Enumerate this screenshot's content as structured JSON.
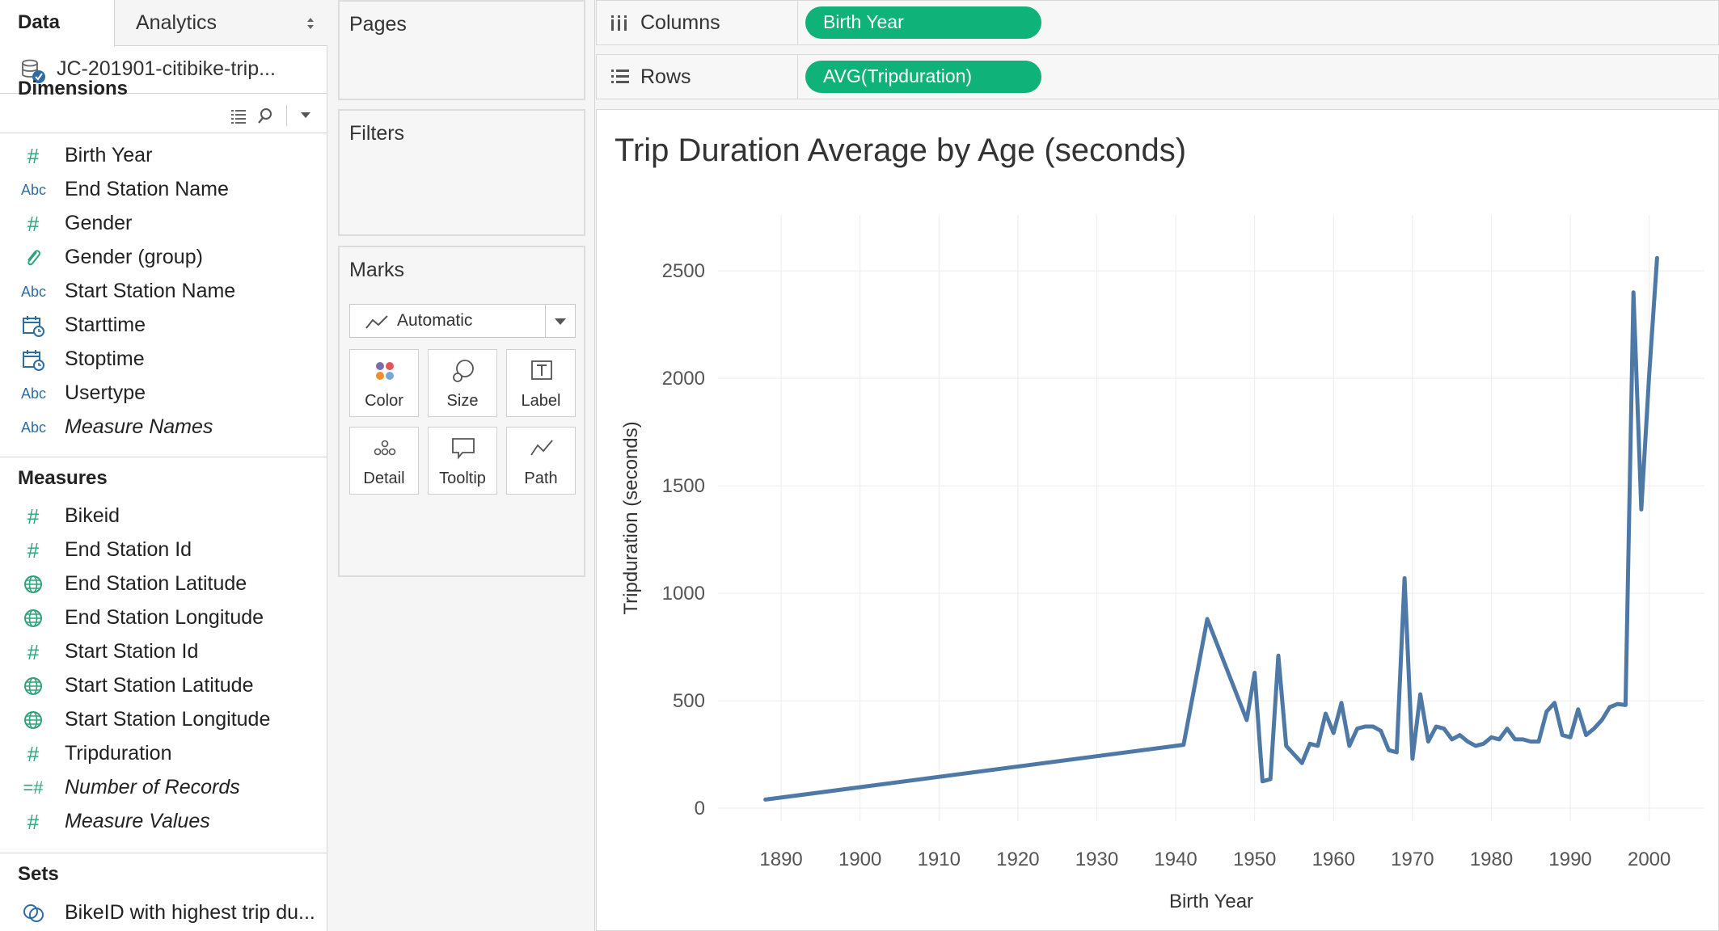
{
  "tabs": {
    "data": "Data",
    "analytics": "Analytics"
  },
  "datasource": {
    "label": "JC-201901-citibike-trip...",
    "icon": "datasource-icon"
  },
  "dimensions": {
    "heading": "Dimensions",
    "items": [
      {
        "label": "Birth Year",
        "icon": "number-icon",
        "italic": false
      },
      {
        "label": "End Station Name",
        "icon": "abc-icon",
        "italic": false
      },
      {
        "label": "Gender",
        "icon": "number-icon",
        "italic": false
      },
      {
        "label": "Gender (group)",
        "icon": "paperclip-icon",
        "italic": false
      },
      {
        "label": "Start Station Name",
        "icon": "abc-icon",
        "italic": false
      },
      {
        "label": "Starttime",
        "icon": "calendar-time-icon",
        "italic": false
      },
      {
        "label": "Stoptime",
        "icon": "calendar-time-icon",
        "italic": false
      },
      {
        "label": "Usertype",
        "icon": "abc-icon",
        "italic": false
      },
      {
        "label": "Measure Names",
        "icon": "abc-icon",
        "italic": true
      }
    ]
  },
  "measures": {
    "heading": "Measures",
    "items": [
      {
        "label": "Bikeid",
        "icon": "number-icon",
        "italic": false
      },
      {
        "label": "End Station Id",
        "icon": "number-icon",
        "italic": false
      },
      {
        "label": "End Station Latitude",
        "icon": "globe-icon",
        "italic": false
      },
      {
        "label": "End Station Longitude",
        "icon": "globe-icon",
        "italic": false
      },
      {
        "label": "Start Station Id",
        "icon": "number-icon",
        "italic": false
      },
      {
        "label": "Start Station Latitude",
        "icon": "globe-icon",
        "italic": false
      },
      {
        "label": "Start Station Longitude",
        "icon": "globe-icon",
        "italic": false
      },
      {
        "label": "Tripduration",
        "icon": "number-icon",
        "italic": false
      },
      {
        "label": "Number of Records",
        "icon": "calc-number-icon",
        "italic": true
      },
      {
        "label": "Measure Values",
        "icon": "number-icon",
        "italic": true
      }
    ]
  },
  "sets": {
    "heading": "Sets",
    "items": [
      {
        "label": "BikeID with highest trip du...",
        "icon": "set-icon"
      }
    ]
  },
  "cards": {
    "pages": "Pages",
    "filters": "Filters",
    "marks": {
      "title": "Marks",
      "mark_type": "Automatic",
      "buttons": [
        "Color",
        "Size",
        "Label",
        "Detail",
        "Tooltip",
        "Path"
      ]
    }
  },
  "shelves": {
    "columns": {
      "label": "Columns",
      "pill": "Birth Year"
    },
    "rows": {
      "label": "Rows",
      "pill": "AVG(Tripduration)"
    }
  },
  "colors": {
    "pill": "#0fb278",
    "line": "#4e79a7",
    "field_icon": "#2ea37a"
  },
  "chart_data": {
    "type": "line",
    "title": "Trip Duration Average by Age  (seconds)",
    "xlabel": "Birth Year",
    "ylabel": "Tripduration (seconds)",
    "xlim": [
      1882,
      2007
    ],
    "ylim": [
      -60,
      2760
    ],
    "xticks": [
      1890,
      1900,
      1910,
      1920,
      1930,
      1940,
      1950,
      1960,
      1970,
      1980,
      1990,
      2000
    ],
    "yticks": [
      0,
      500,
      1000,
      1500,
      2000,
      2500
    ],
    "grid": true,
    "series": [
      {
        "x": [
          1888,
          1941,
          1944,
          1949,
          1950,
          1951,
          1952,
          1953,
          1954,
          1956,
          1957,
          1958,
          1959,
          1960,
          1961,
          1962,
          1963,
          1964,
          1965,
          1966,
          1967,
          1968,
          1969,
          1970,
          1971,
          1972,
          1973,
          1974,
          1975,
          1976,
          1977,
          1978,
          1979,
          1980,
          1981,
          1982,
          1983,
          1984,
          1985,
          1986,
          1987,
          1988,
          1989,
          1990,
          1991,
          1992,
          1993,
          1994,
          1995,
          1996,
          1997,
          1998,
          1999,
          2000,
          2001
        ],
        "y": [
          40,
          295,
          880,
          410,
          630,
          125,
          135,
          710,
          290,
          210,
          300,
          290,
          440,
          350,
          490,
          290,
          370,
          380,
          380,
          360,
          270,
          260,
          1070,
          230,
          530,
          310,
          380,
          370,
          320,
          340,
          310,
          290,
          300,
          330,
          320,
          370,
          320,
          320,
          310,
          310,
          450,
          490,
          340,
          330,
          460,
          340,
          370,
          410,
          470,
          485,
          480,
          2400,
          1390,
          2020,
          2560
        ]
      }
    ]
  }
}
